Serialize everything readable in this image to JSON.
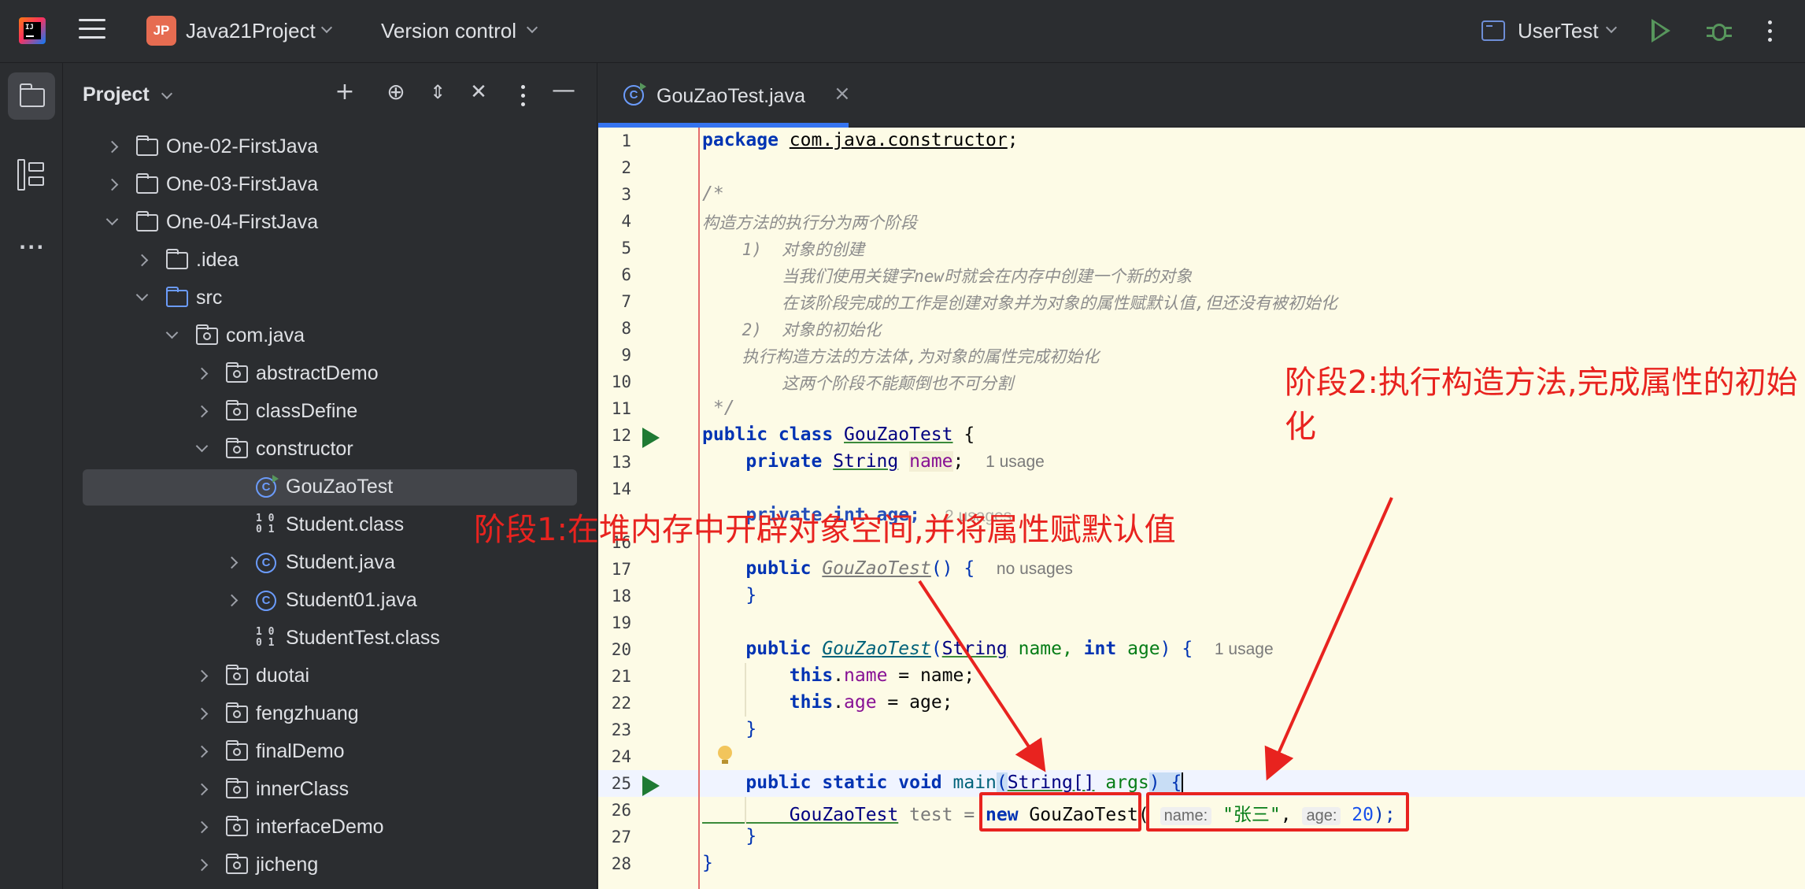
{
  "titlebar": {
    "project_badge": "JP",
    "project_name": "Java21Project",
    "version_control": "Version control",
    "run_config": "UserTest"
  },
  "project_panel": {
    "title": "Project",
    "tree": [
      {
        "label": "One-02-FirstJava",
        "type": "folder",
        "state": "closed",
        "depth": 0
      },
      {
        "label": "One-03-FirstJava",
        "type": "folder",
        "state": "closed",
        "depth": 0
      },
      {
        "label": "One-04-FirstJava",
        "type": "folder",
        "state": "open",
        "depth": 0
      },
      {
        "label": ".idea",
        "type": "folder",
        "state": "closed",
        "depth": 1
      },
      {
        "label": "src",
        "type": "folder-blue",
        "state": "open",
        "depth": 1
      },
      {
        "label": "com.java",
        "type": "package",
        "state": "open",
        "depth": 2
      },
      {
        "label": "abstractDemo",
        "type": "package",
        "state": "closed",
        "depth": 3
      },
      {
        "label": "classDefine",
        "type": "package",
        "state": "closed",
        "depth": 3
      },
      {
        "label": "constructor",
        "type": "package",
        "state": "open",
        "depth": 3
      },
      {
        "label": "GouZaoTest",
        "type": "class-run",
        "state": "none",
        "depth": 4,
        "selected": true
      },
      {
        "label": "Student.class",
        "type": "binary",
        "state": "none",
        "depth": 4
      },
      {
        "label": "Student.java",
        "type": "class",
        "state": "closed",
        "depth": 4
      },
      {
        "label": "Student01.java",
        "type": "class",
        "state": "closed",
        "depth": 4
      },
      {
        "label": "StudentTest.class",
        "type": "binary",
        "state": "none",
        "depth": 4
      },
      {
        "label": "duotai",
        "type": "package",
        "state": "closed",
        "depth": 3
      },
      {
        "label": "fengzhuang",
        "type": "package",
        "state": "closed",
        "depth": 3
      },
      {
        "label": "finalDemo",
        "type": "package",
        "state": "closed",
        "depth": 3
      },
      {
        "label": "innerClass",
        "type": "package",
        "state": "closed",
        "depth": 3
      },
      {
        "label": "interfaceDemo",
        "type": "package",
        "state": "closed",
        "depth": 3
      },
      {
        "label": "jicheng",
        "type": "package",
        "state": "closed",
        "depth": 3
      }
    ]
  },
  "editor": {
    "tab_label": "GouZaoTest.java",
    "line_numbers": [
      "1",
      "2",
      "3",
      "4",
      "5",
      "6",
      "7",
      "8",
      "9",
      "10",
      "11",
      "12",
      "13",
      "14",
      "",
      "16",
      "17",
      "18",
      "19",
      "20",
      "21",
      "22",
      "23",
      "24",
      "25",
      "26",
      "27",
      "28"
    ],
    "code": {
      "l1_package": "package",
      "l1_name": "com.java.constructor",
      "l1_semicolon": ";",
      "l3": "/*",
      "l4": "构造方法的执行分为两个阶段",
      "l5": "    1)  对象的创建",
      "l6": "        当我们使用关键字new时就会在内存中创建一个新的对象",
      "l7": "        在该阶段完成的工作是创建对象并为对象的属性赋默认值,但还没有被初始化",
      "l8": "    2)  对象的初始化",
      "l9": "    执行构造方法的方法体,为对象的属性完成初始化",
      "l10": "        这两个阶段不能颠倒也不可分割",
      "l11": " */",
      "l12_mods": "public class ",
      "l12_name": "GouZaoTest",
      "l12_brace": " {",
      "l13_mods": "    private ",
      "l13_type": "String",
      "l13_field": "name",
      "l13_semi": ";",
      "l13_hint": "1 usage",
      "l15_fragment": "    private int age;",
      "l15_hint": "2 usages",
      "l17_mods": "    public ",
      "l17_name": "GouZaoTest",
      "l17_rest": "() {",
      "l17_hint": "no usages",
      "l18": "    }",
      "l20_mods": "    public ",
      "l20_name": "GouZaoTest",
      "l20_open": "(",
      "l20_type": "String",
      "l20_p1": " name, ",
      "l20_int": "int",
      "l20_p2": " age",
      "l20_close": ") {",
      "l20_hint": "1 usage",
      "l21_this": "        this",
      "l21_dot": ".",
      "l21_field": "name",
      "l21_rest": " = name;",
      "l22_this": "        this",
      "l22_dot": ".",
      "l22_field": "age",
      "l22_rest": " = age;",
      "l23": "    }",
      "l25_mods": "    public static void ",
      "l25_name": "main",
      "l25_open": "(",
      "l25_type": "String[]",
      "l25_arg": " args",
      "l25_close": ") {",
      "l26_type": "        GouZaoTest",
      "l26_var": " test = ",
      "l26_new": "new ",
      "l26_cls": "GouZaoTest",
      "l26_open": "(",
      "l26_hint_name": "name:",
      "l26_str": "\"张三\"",
      "l26_comma": ", ",
      "l26_hint_age": "age:",
      "l26_num": "20",
      "l26_close": ");",
      "l27": "    }",
      "l28": "}"
    }
  },
  "annotations": {
    "stage1": "阶段1:在堆内存中开辟对象空间,并将属性赋默认值",
    "stage2": "阶段2:执行构造方法,完成属性的初始化"
  },
  "colors": {
    "annotation_red": "#e8231f",
    "editor_bg": "#fdfbe6",
    "ide_dark": "#2b2d30",
    "accent_blue": "#3574f0",
    "run_green": "#57965c"
  }
}
